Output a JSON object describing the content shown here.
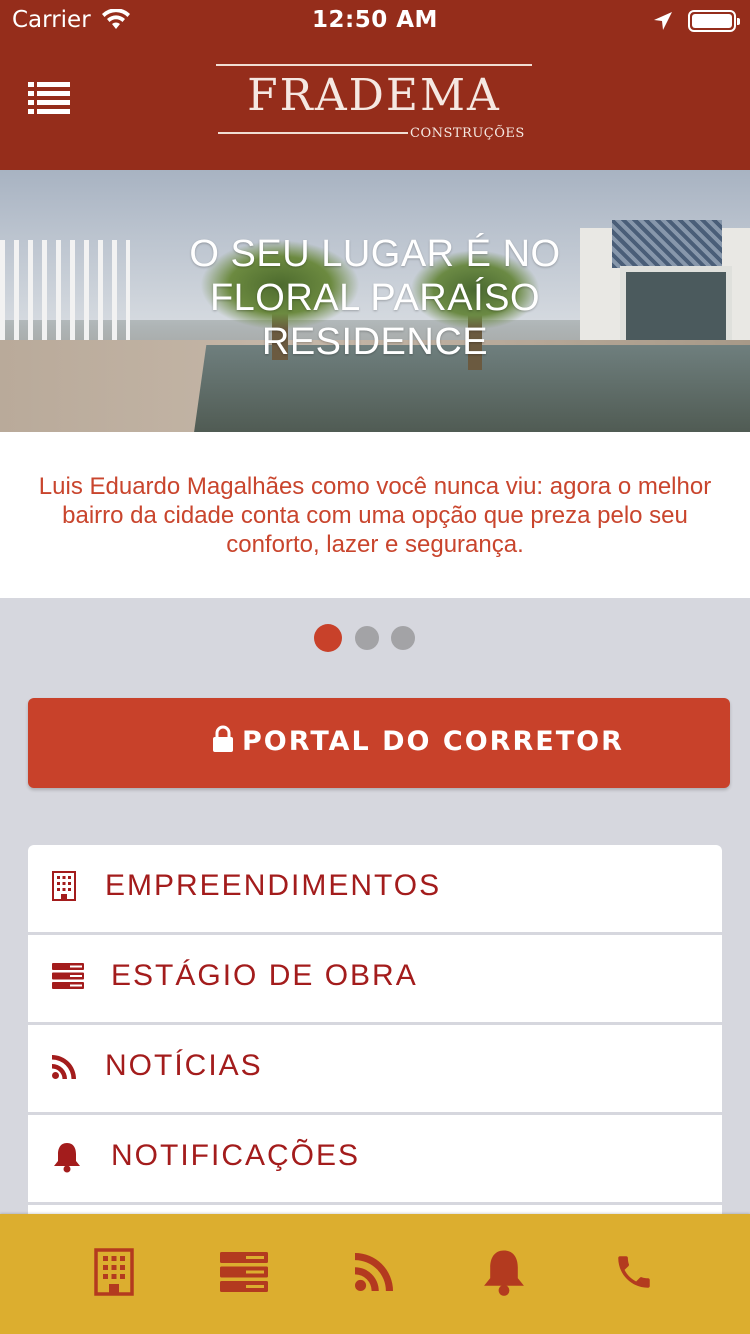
{
  "status_bar": {
    "carrier": "Carrier",
    "time": "12:50 AM",
    "icons": [
      "wifi-icon",
      "location-arrow-icon",
      "battery-icon"
    ]
  },
  "header": {
    "menu_icon": "list-menu-icon",
    "logo": {
      "name": "FRADEMA",
      "subtitle": "CONSTRUÇÕES"
    }
  },
  "hero": {
    "title_lines": [
      "O SEU LUGAR É NO",
      "FLORAL PARAÍSO",
      "RESIDENCE"
    ],
    "description": "Luis Eduardo Magalhães como você nunca viu: agora o melhor bairro da cidade conta com uma opção que preza pelo seu conforto, lazer e segurança."
  },
  "pager": {
    "total": 3,
    "active_index": 0
  },
  "portal_button": {
    "label": "PORTAL DO CORRETOR",
    "icon": "lock-icon"
  },
  "menu": {
    "items": [
      {
        "label": "EMPREENDIMENTOS",
        "icon": "building-icon"
      },
      {
        "label": "ESTÁGIO DE OBRA",
        "icon": "server-stack-icon"
      },
      {
        "label": "NOTÍCIAS",
        "icon": "rss-icon"
      },
      {
        "label": "NOTIFICAÇÕES",
        "icon": "bell-icon"
      }
    ]
  },
  "tab_bar": {
    "tabs": [
      {
        "icon": "building-icon"
      },
      {
        "icon": "server-stack-icon"
      },
      {
        "icon": "rss-icon"
      },
      {
        "icon": "bell-icon"
      },
      {
        "icon": "phone-icon"
      }
    ]
  },
  "colors": {
    "header_bg": "#952d1b",
    "accent": "#c8412a",
    "menu_text": "#a31c1c",
    "tabbar_bg": "#dcae2f",
    "tabbar_icon": "#b33a1f",
    "page_bg": "#d6d7de"
  }
}
